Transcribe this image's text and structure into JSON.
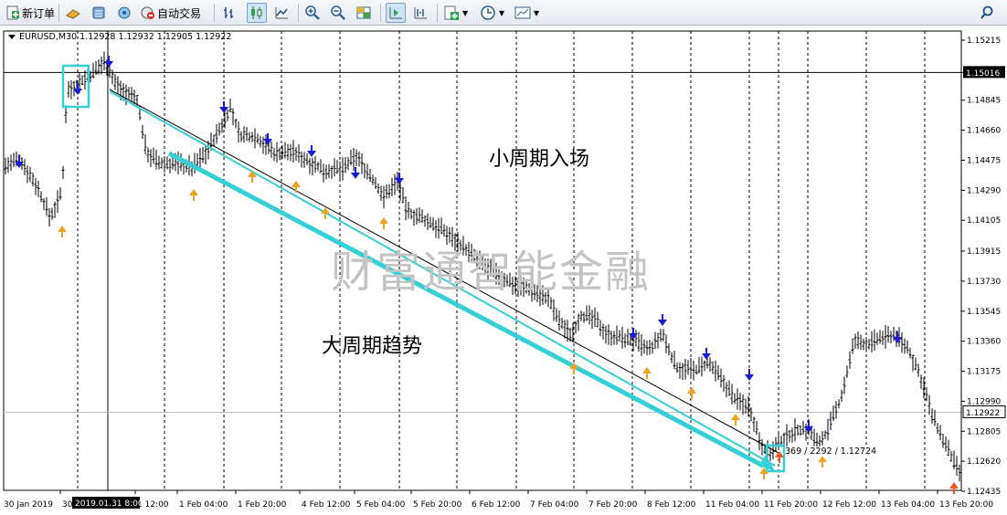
{
  "toolbar": {
    "new_order_label": "新订单",
    "auto_trading_label": "自动交易"
  },
  "chart": {
    "symbol_info": "EURUSD,M30  1.12928 1.12932 1.12905 1.12922",
    "crosshair_price": "1.15016",
    "current_price": "1.12922",
    "crosshair_time": "2019.01.31 8:00",
    "cursor_readout": "369 / 2292 / 1.12724",
    "price_labels": [
      "1.15215",
      "1.15016",
      "1.14845",
      "1.14660",
      "1.14475",
      "1.14290",
      "1.14105",
      "1.13915",
      "1.13730",
      "1.13545",
      "1.13360",
      "1.13175",
      "1.12990",
      "1.12805",
      "1.12620",
      "1.12435"
    ],
    "time_labels": [
      "30 Jan 2019",
      "30",
      "1 12:00",
      "1 Feb 04:00",
      "1 Feb 20:00",
      "4 Feb 12:00",
      "5 Feb 04:00",
      "5 Feb 20:00",
      "6 Feb 12:00",
      "7 Feb 04:00",
      "7 Feb 20:00",
      "8 Feb 12:00",
      "11 Feb 04:00",
      "11 Feb 20:00",
      "12 Feb 12:00",
      "13 Feb 04:00",
      "13 Feb 20:00"
    ],
    "annotation_small_cycle": "小周期入场",
    "annotation_big_cycle": "大周期趋势",
    "watermark": "财富通智能金融",
    "colors": {
      "background": "#ffffff",
      "bars": "#000000",
      "grid": "#000000",
      "trend_thick": "#35cfd6",
      "down_arrow": "#1a1ad2",
      "up_arrow": "#f2a21e",
      "up_arrow_last": "#f25a1e",
      "watermark": "#c8c8c8",
      "current_price_line": "#c0c0c0"
    }
  }
}
